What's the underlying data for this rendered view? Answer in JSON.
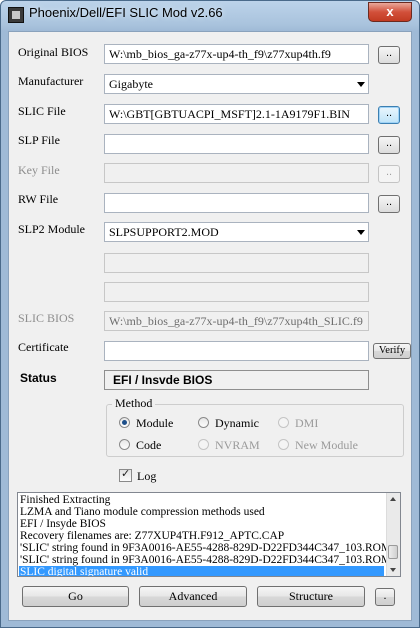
{
  "window": {
    "title": "Phoenix/Dell/EFI SLIC Mod v2.66",
    "close_label": "x"
  },
  "fields": {
    "original_bios": {
      "label": "Original BIOS",
      "value": "W:\\mb_bios_ga-z77x-up4-th_f9\\z77xup4th.f9",
      "browse": ".."
    },
    "manufacturer": {
      "label": "Manufacturer",
      "value": "Gigabyte"
    },
    "slic_file": {
      "label": "SLIC File",
      "value": "W:\\GBT[GBTUACPI_MSFT]2.1-1A9179F1.BIN",
      "browse": ".."
    },
    "slp_file": {
      "label": "SLP File",
      "value": "",
      "browse": ".."
    },
    "key_file": {
      "label": "Key File",
      "value": "",
      "browse": ".."
    },
    "rw_file": {
      "label": "RW File",
      "value": "",
      "browse": ".."
    },
    "slp2_module": {
      "label": "SLP2 Module",
      "value": "SLPSUPPORT2.MOD"
    },
    "slic_bios": {
      "label": "SLIC BIOS",
      "value": "W:\\mb_bios_ga-z77x-up4-th_f9\\z77xup4th_SLIC.f9"
    },
    "certificate": {
      "label": "Certificate",
      "value": "",
      "verify": "Verify"
    }
  },
  "status": {
    "label": "Status",
    "value": "EFI / Insvde BIOS"
  },
  "method": {
    "title": "Method",
    "options": [
      "Module",
      "Dynamic",
      "DMI",
      "Code",
      "NVRAM",
      "New Module"
    ],
    "selected": "Module"
  },
  "log_checkbox": {
    "label": "Log",
    "checked": true
  },
  "log_lines": [
    "Finished Extracting",
    "LZMA and Tiano module compression methods used",
    "EFI / Insyde BIOS",
    "Recovery filenames are:     Z77XUP4TH.F912_APTC.CAP",
    "'SLIC' string found in 9F3A0016-AE55-4288-829D-D22FD344C347_103.ROM",
    "'SLIC' string found in 9F3A0016-AE55-4288-829D-D22FD344C347_103.ROM",
    "SLIC digital signature valid"
  ],
  "buttons": {
    "go": "Go",
    "advanced": "Advanced",
    "structure": "Structure",
    "dot": "."
  }
}
